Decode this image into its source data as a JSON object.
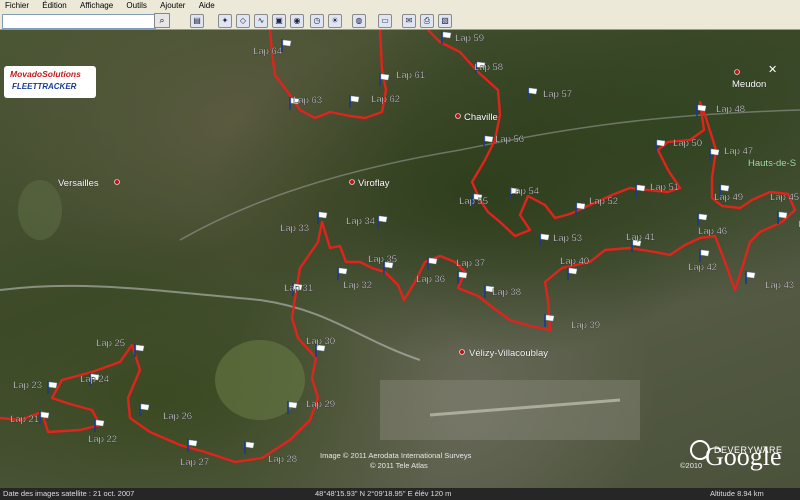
{
  "menu": [
    "Fichier",
    "Édition",
    "Affichage",
    "Outils",
    "Ajouter",
    "Aide"
  ],
  "toolbar": {
    "search_placeholder": ""
  },
  "logo": {
    "line1": "MovadoSolutions",
    "line2": "FLEETTRACKER"
  },
  "places": [
    {
      "id": "versailles",
      "label": "Versailles"
    },
    {
      "id": "viroflay",
      "label": "Viroflay"
    },
    {
      "id": "chaville",
      "label": "Chaville"
    },
    {
      "id": "meudon",
      "label": "Meudon"
    },
    {
      "id": "hauts",
      "label": "Hauts-de-S"
    },
    {
      "id": "velizy",
      "label": "Vélizy-Villacoublay"
    }
  ],
  "laps": [
    "Lap 21",
    "Lap 22",
    "Lap 23",
    "Lap 24",
    "Lap 25",
    "Lap 26",
    "Lap 27",
    "Lap 28",
    "Lap 29",
    "Lap 30",
    "Lap 31",
    "Lap 32",
    "Lap 33",
    "Lap 34",
    "Lap 35",
    "Lap 36",
    "Lap 37",
    "Lap 38",
    "Lap 39",
    "Lap 40",
    "Lap 41",
    "Lap 42",
    "Lap 43",
    "Lap 45",
    "Lap 46",
    "Lap 47",
    "Lap 48",
    "Lap 49",
    "Lap 50",
    "Lap 51",
    "Lap 52",
    "Lap 53",
    "Lap 54",
    "Lap 55",
    "Lap 56",
    "Lap 57",
    "Lap 58",
    "Lap 59",
    "Lap 61",
    "Lap 62",
    "Lap 63",
    "Lap 64",
    "Le"
  ],
  "copyright": {
    "line1": "Image © 2011 Aerodata International Surveys",
    "line2": "© 2011 Tele Atlas",
    "year": "©2010"
  },
  "brand": {
    "name": "DEVERYWARE",
    "google": "Google"
  },
  "status": {
    "date": "Date des images satellite : 21 oct. 2007",
    "coords": "48°48'15.93\" N    2°09'18.95\" E   élév  120 m",
    "altitude": "Altitude      8.94 km"
  },
  "colors": {
    "route": "#e0241b",
    "flag": "#1a3a8a"
  }
}
